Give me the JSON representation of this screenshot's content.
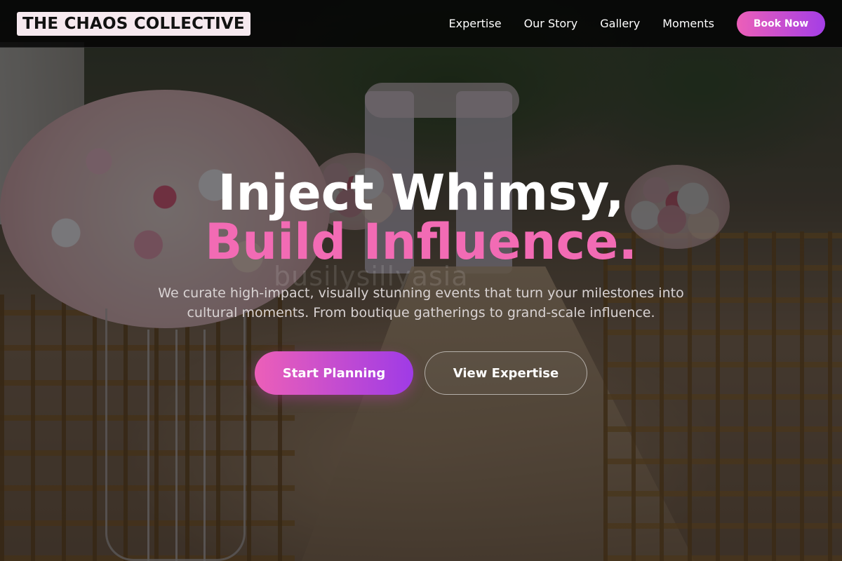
{
  "header": {
    "logo_text": "THE CHAOS COLLECTIVE",
    "nav": [
      {
        "label": "Expertise"
      },
      {
        "label": "Our Story"
      },
      {
        "label": "Gallery"
      },
      {
        "label": "Moments"
      }
    ],
    "book_label": "Book Now"
  },
  "hero": {
    "headline_line1": "Inject Whimsy,",
    "headline_line2": "Build Influence.",
    "subtitle": "We curate high-impact, visually stunning events that turn your milestones into cultural moments. From boutique gatherings to grand-scale influence.",
    "primary_cta": "Start Planning",
    "secondary_cta": "View Expertise",
    "watermark": "busilysillyasia"
  },
  "colors": {
    "accent_pink": "#f26bb4",
    "gradient_start": "#ec5fb8",
    "gradient_end": "#a43ee6",
    "header_bg": "#050505"
  }
}
